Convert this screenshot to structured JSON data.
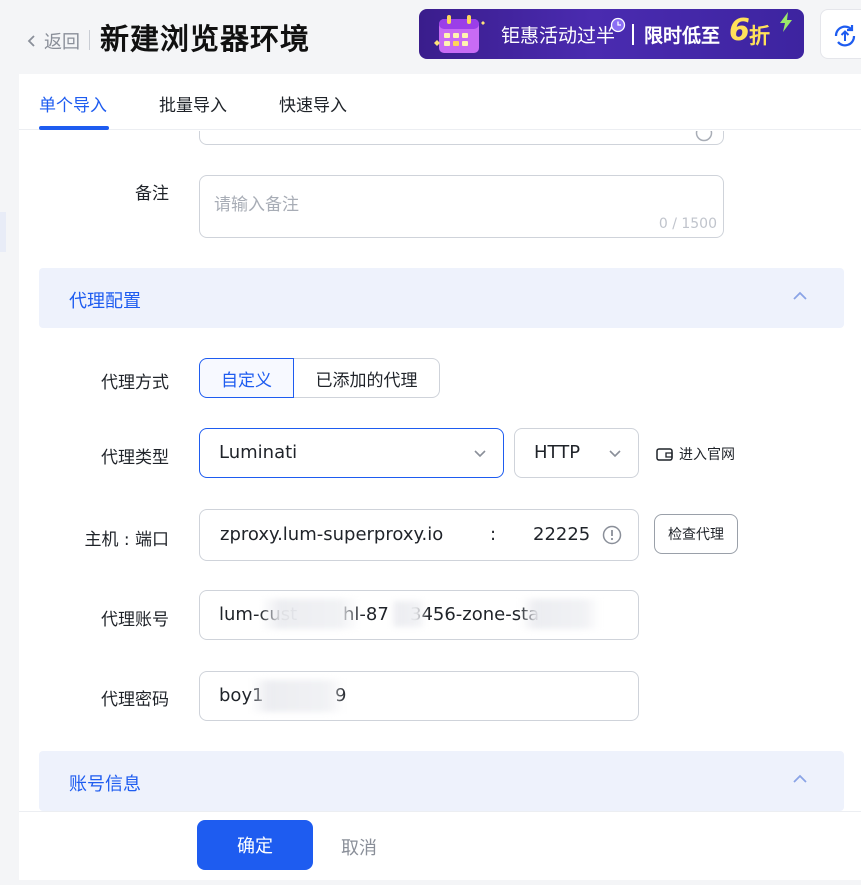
{
  "header": {
    "back_label": "返回",
    "title": "新建浏览器环境",
    "promo": {
      "text1": "钜惠活动过半",
      "text2": "限时低至",
      "discount_num": "6",
      "discount_unit": "折"
    },
    "sync_icon": "sync-upload-icon"
  },
  "tabs": [
    {
      "label": "单个导入",
      "active": true
    },
    {
      "label": "批量导入",
      "active": false
    },
    {
      "label": "快速导入",
      "active": false
    }
  ],
  "form": {
    "remark": {
      "label": "备注",
      "placeholder": "请输入备注",
      "counter": "0 / 1500"
    },
    "proxy_section": {
      "title": "代理配置"
    },
    "proxy_method": {
      "label": "代理方式",
      "options": [
        "自定义",
        "已添加的代理"
      ],
      "selected": "自定义"
    },
    "proxy_type": {
      "label": "代理类型",
      "provider": "Luminati",
      "protocol": "HTTP",
      "official_link": "进入官网"
    },
    "host_port": {
      "label": "主机 : 端口",
      "host": "zproxy.lum-superproxy.io",
      "separator": ":",
      "port": "22225",
      "check_button": "检查代理"
    },
    "proxy_account": {
      "label": "代理账号",
      "value_visible_start": "lum-cust",
      "value_visible_mid": "hl-87",
      "value_visible_end": "3456-zone-sta"
    },
    "proxy_password": {
      "label": "代理密码",
      "value_visible": "boy1",
      "value_visible_end": "9"
    },
    "account_section": {
      "title": "账号信息"
    }
  },
  "footer": {
    "confirm_label": "确定",
    "cancel_label": "取消"
  },
  "colors": {
    "primary": "#1e5cf0",
    "section_bg": "#eef2fc",
    "border": "#cfd3da"
  }
}
